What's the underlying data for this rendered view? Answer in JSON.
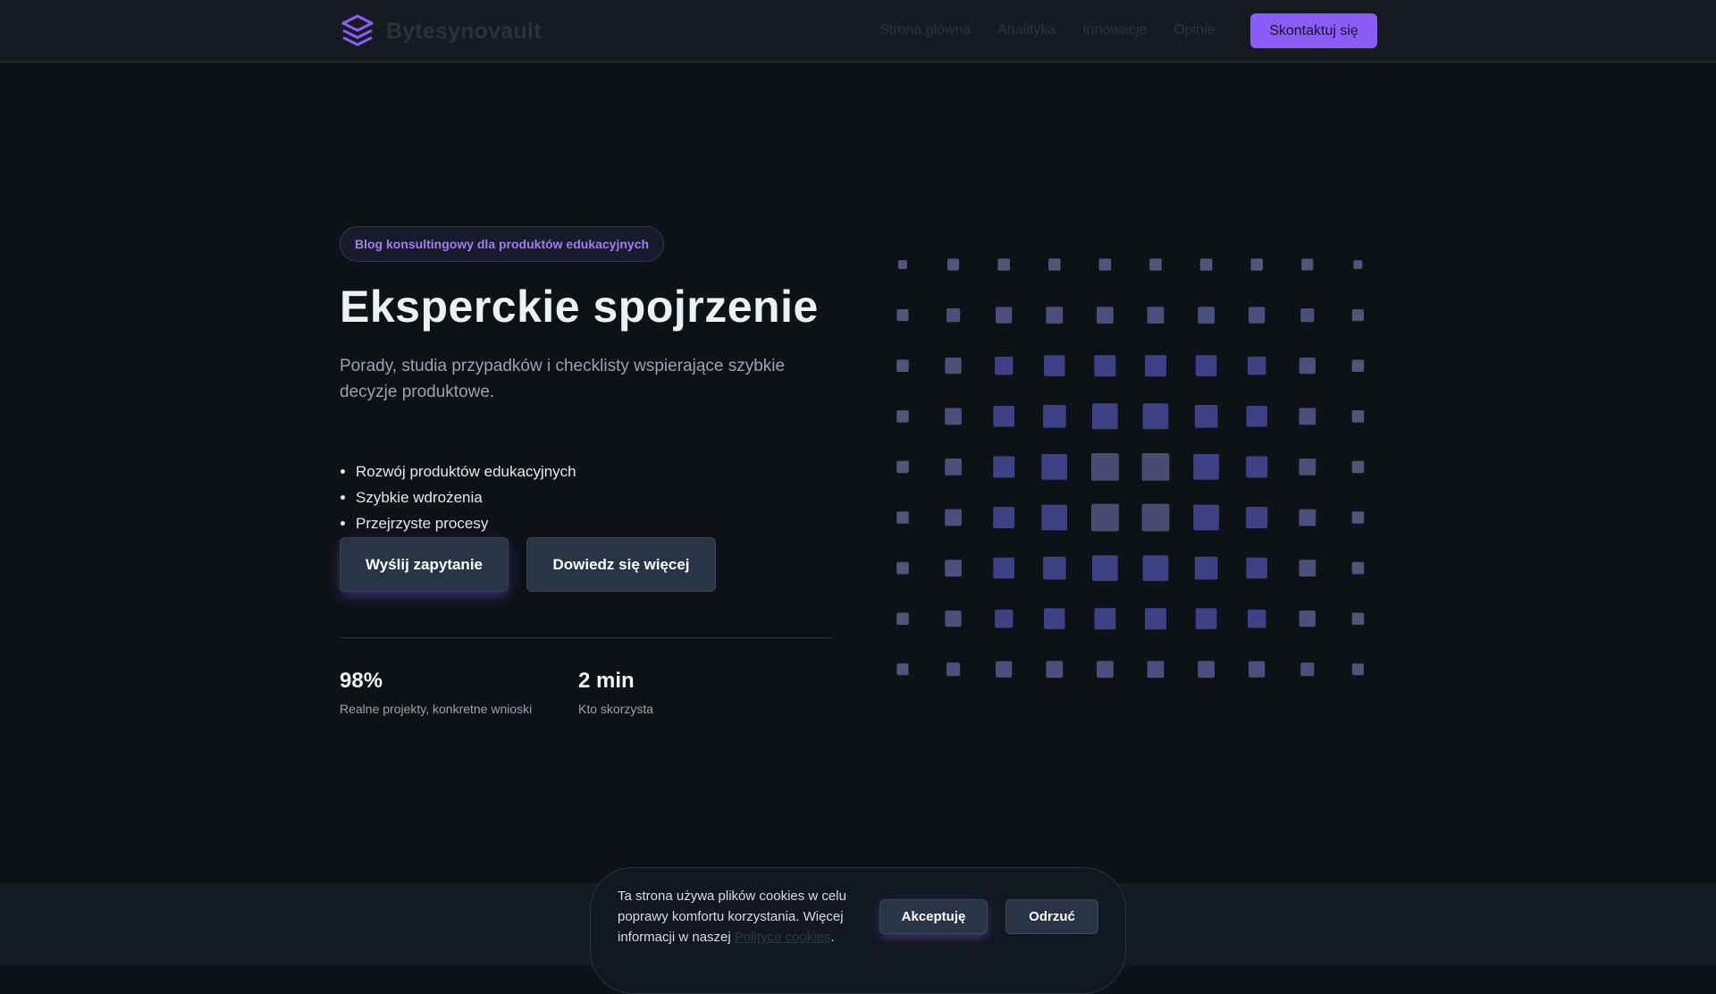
{
  "brand": {
    "name": "Bytesynovault",
    "accent": "#8b5cf6"
  },
  "nav": {
    "items": [
      "Strona główna",
      "Analityka",
      "Innowacje",
      "Opinie"
    ],
    "cta": "Skontaktuj się"
  },
  "hero": {
    "badge": "Blog konsultingowy dla produktów edukacyjnych",
    "title": "Eksperckie spojrzenie",
    "subtitle": "Porady, studia przypadków i checklisty wspierające szybkie decyzje produktowe.",
    "bullets": [
      "Rozwój produktów edukacyjnych",
      "Szybkie wdrożenia",
      "Przejrzyste procesy"
    ],
    "primary_button": "Wyślij zapytanie",
    "secondary_button": "Dowiedz się więcej",
    "stats": [
      {
        "value": "98%",
        "label": "Realne projekty, konkretne wnioski"
      },
      {
        "value": "2 min",
        "label": "Kto skorzysta"
      }
    ]
  },
  "cookie": {
    "text_before": "Ta strona używa plików cookies w celu poprawy komfortu korzystania. Więcej informacji w naszej ",
    "link": "Polityce cookies",
    "text_after": ".",
    "accept": "Akceptuję",
    "reject": "Odrzuć"
  }
}
